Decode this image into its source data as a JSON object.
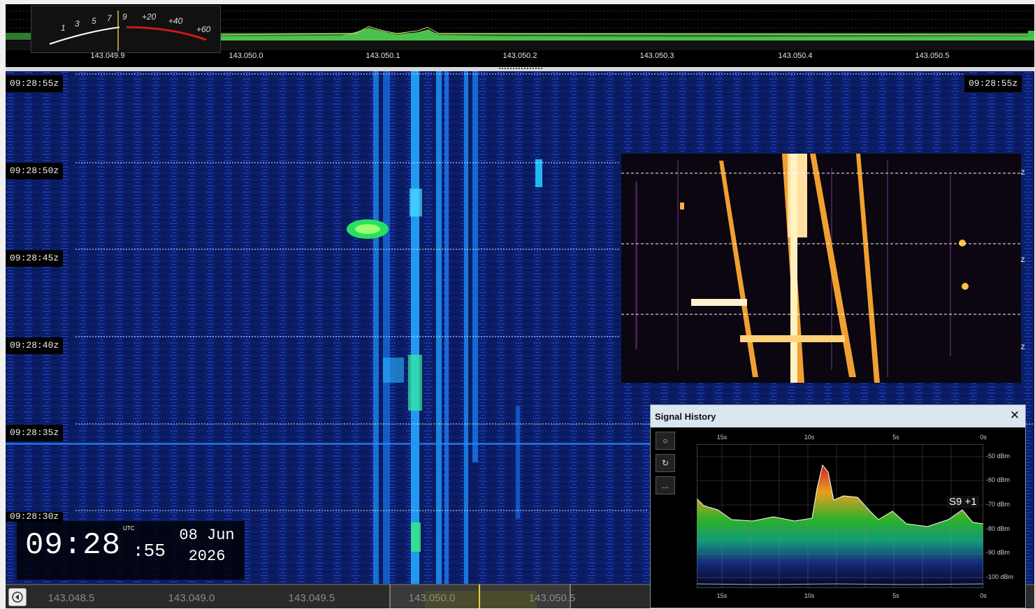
{
  "smeter": {
    "scale_s": [
      "1",
      "3",
      "5",
      "7",
      "9"
    ],
    "scale_db": [
      "+20",
      "+40",
      "+60"
    ]
  },
  "top_axis": {
    "labels": [
      "143.049.9",
      "143.050.0",
      "143.050.1",
      "143.050.2",
      "143.050.3",
      "143.050.4",
      "143.050.5"
    ]
  },
  "waterfall": {
    "timestamps": [
      "09:28:55z",
      "09:28:50z",
      "09:28:45z",
      "09:28:40z",
      "09:28:35z",
      "09:28:30z"
    ],
    "right_timestamp": "09:28:55z",
    "zoom_markers": [
      "z",
      "z",
      "z"
    ]
  },
  "clock": {
    "time_hm": "09:28",
    "time_s": ":55",
    "tz": "UTC",
    "date_day": "08 Jun",
    "date_year": "2026"
  },
  "bottom_axis": {
    "labels": [
      "143.048.5",
      "143.049.0",
      "143.049.5",
      "143.050.0",
      "143.050.5"
    ]
  },
  "signal_history": {
    "title": "Signal History",
    "close": "✕",
    "buttons": [
      "○",
      "↻",
      "..."
    ],
    "x_labels": [
      "15s",
      "10s",
      "5s",
      "0s"
    ],
    "y_labels": [
      "-50 dBm",
      "-60 dBm",
      "-70 dBm",
      "-80 dBm",
      "-90 dBm",
      "-100 dBm"
    ],
    "s_reading": "S9 +1"
  },
  "colors": {
    "waterfall_bg": "#0a1a5a",
    "signal": "#22c8ff",
    "zoom_hot": "#ffd070",
    "spectrum_green": "#3fae3f",
    "meter_red": "#d01818"
  }
}
